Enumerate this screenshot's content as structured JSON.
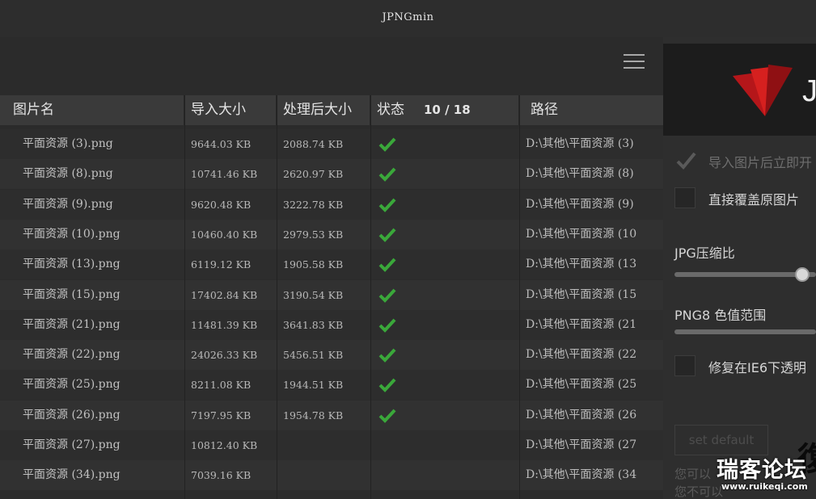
{
  "window": {
    "title": "JPNGmin"
  },
  "table": {
    "headers": {
      "name": "图片名",
      "import_size": "导入大小",
      "processed_size": "处理后大小",
      "status": "状态",
      "progress": "10 / 18",
      "path": "路径"
    },
    "rows": [
      {
        "name": "平面资源 (3).png",
        "import_size": "9644.03 KB",
        "processed_size": "2088.74 KB",
        "done": true,
        "path": "D:\\其他\\平面资源 (3)"
      },
      {
        "name": "平面资源 (8).png",
        "import_size": "10741.46 KB",
        "processed_size": "2620.97 KB",
        "done": true,
        "path": "D:\\其他\\平面资源 (8)"
      },
      {
        "name": "平面资源 (9).png",
        "import_size": "9620.48 KB",
        "processed_size": "3222.78 KB",
        "done": true,
        "path": "D:\\其他\\平面资源 (9)"
      },
      {
        "name": "平面资源 (10).png",
        "import_size": "10460.40 KB",
        "processed_size": "2979.53 KB",
        "done": true,
        "path": "D:\\其他\\平面资源 (10"
      },
      {
        "name": "平面资源 (13).png",
        "import_size": "6119.12 KB",
        "processed_size": "1905.58 KB",
        "done": true,
        "path": "D:\\其他\\平面资源 (13"
      },
      {
        "name": "平面资源 (15).png",
        "import_size": "17402.84 KB",
        "processed_size": "3190.54 KB",
        "done": true,
        "path": "D:\\其他\\平面资源 (15"
      },
      {
        "name": "平面资源 (21).png",
        "import_size": "11481.39 KB",
        "processed_size": "3641.83 KB",
        "done": true,
        "path": "D:\\其他\\平面资源 (21"
      },
      {
        "name": "平面资源 (22).png",
        "import_size": "24026.33 KB",
        "processed_size": "5456.51 KB",
        "done": true,
        "path": "D:\\其他\\平面资源 (22"
      },
      {
        "name": "平面资源 (25).png",
        "import_size": "8211.08 KB",
        "processed_size": "1944.51 KB",
        "done": true,
        "path": "D:\\其他\\平面资源 (25"
      },
      {
        "name": "平面资源 (26).png",
        "import_size": "7197.95 KB",
        "processed_size": "1954.78 KB",
        "done": true,
        "path": "D:\\其他\\平面资源 (26"
      },
      {
        "name": "平面资源 (27).png",
        "import_size": "10812.40 KB",
        "processed_size": "",
        "done": false,
        "path": "D:\\其他\\平面资源 (27"
      },
      {
        "name": "平面资源 (34).png",
        "import_size": "7039.16 KB",
        "processed_size": "",
        "done": false,
        "path": "D:\\其他\\平面资源 (34"
      }
    ]
  },
  "panel": {
    "logo_letter": "J",
    "option_auto": "导入图片后立即开",
    "option_overwrite": "直接覆盖原图片",
    "jpg_label": "JPG压缩比",
    "jpg_value_fraction": 0.9,
    "png8_label": "PNG8 色值范围",
    "option_ie6": "修复在IE6下透明",
    "default_button": "set default",
    "hint_line1": "您可以",
    "hint_line2": "您不可以"
  },
  "watermark": {
    "text": "瑞客论坛",
    "url": "www.ruikeqi.com"
  },
  "colors": {
    "check_green": "#3aa83a",
    "logo_red": "#c8171b",
    "background": "#2b2b2b"
  }
}
